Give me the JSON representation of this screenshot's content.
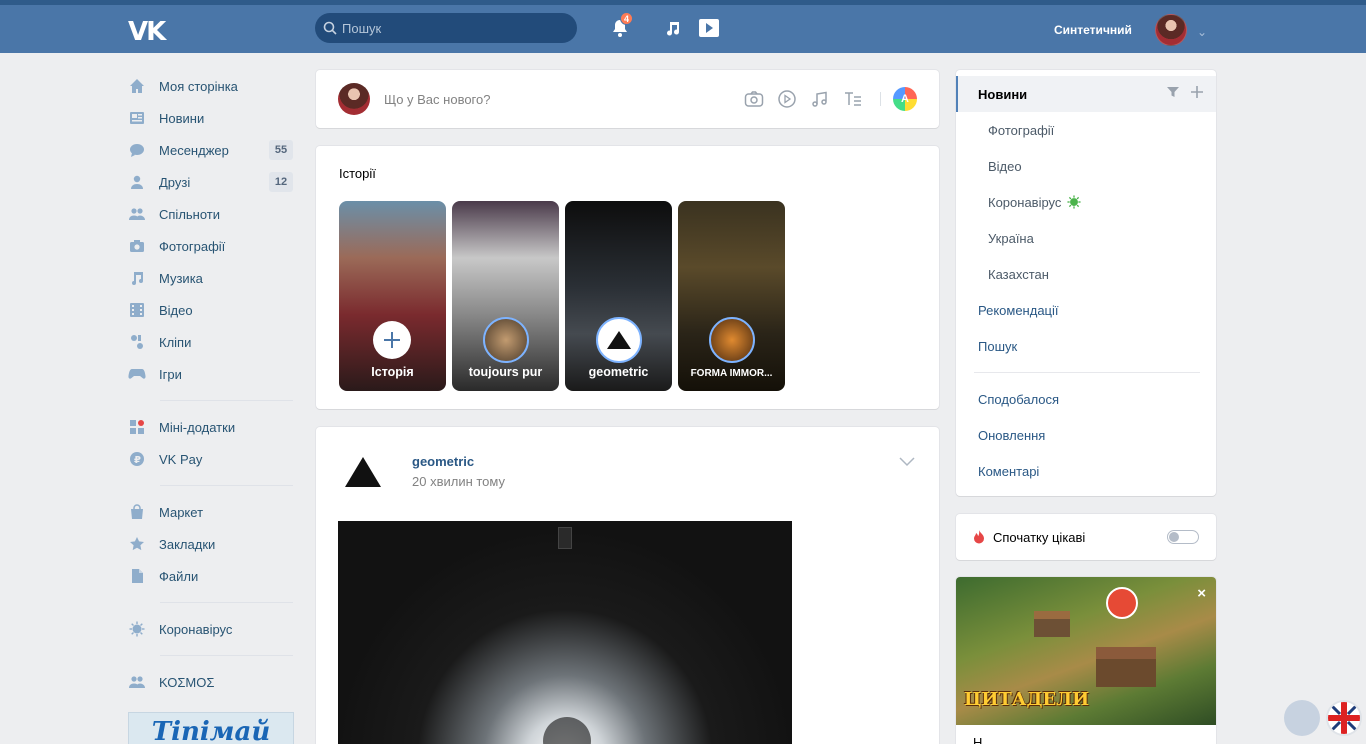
{
  "header": {
    "logo": "VK",
    "search_placeholder": "Пошук",
    "notifications_count": "4",
    "user_name": "Синтетичний"
  },
  "leftnav": {
    "items": [
      {
        "label": "Моя сторінка",
        "icon": "home-icon"
      },
      {
        "label": "Новини",
        "icon": "news-icon"
      },
      {
        "label": "Месенджер",
        "icon": "messenger-icon",
        "count": "55"
      },
      {
        "label": "Друзі",
        "icon": "friends-icon",
        "count": "12"
      },
      {
        "label": "Спільноти",
        "icon": "communities-icon"
      },
      {
        "label": "Фотографії",
        "icon": "camera-icon"
      },
      {
        "label": "Музика",
        "icon": "music-icon"
      },
      {
        "label": "Відео",
        "icon": "video-icon"
      },
      {
        "label": "Кліпи",
        "icon": "clips-icon"
      },
      {
        "label": "Ігри",
        "icon": "games-icon"
      }
    ],
    "apps": [
      {
        "label": "Міні-додатки",
        "icon": "apps-icon"
      },
      {
        "label": "VK Pay",
        "icon": "vkpay-icon"
      }
    ],
    "market": [
      {
        "label": "Маркет",
        "icon": "market-icon"
      },
      {
        "label": "Закладки",
        "icon": "bookmark-icon"
      },
      {
        "label": "Файли",
        "icon": "file-icon"
      }
    ],
    "corona": {
      "label": "Коронавірус",
      "icon": "virus-icon"
    },
    "kosmos": {
      "label": "ΚΟΣΜΟΣ",
      "icon": "group-icon"
    },
    "ad_banner_text": "Tiniмай"
  },
  "post_box": {
    "placeholder": "Що у Вас нового?",
    "avatar_badge": "A"
  },
  "stories": {
    "title": "Історії",
    "items": [
      {
        "label": "Історія"
      },
      {
        "label": "toujours pur"
      },
      {
        "label": "geometric"
      },
      {
        "label": "FORMA IMMOR..."
      }
    ]
  },
  "post": {
    "author": "geometric",
    "time": "20 хвилин тому"
  },
  "right_menu": {
    "items": [
      {
        "label": "Новини",
        "active": true
      },
      {
        "label": "Фотографії",
        "sub": true
      },
      {
        "label": "Відео",
        "sub": true
      },
      {
        "label": "Коронавірус",
        "sub": true,
        "virus": true
      },
      {
        "label": "Україна",
        "sub": true
      },
      {
        "label": "Казахстан",
        "sub": true
      },
      {
        "label": "Рекомендації"
      },
      {
        "label": "Пошук"
      }
    ],
    "items2": [
      {
        "label": "Сподобалося"
      },
      {
        "label": "Оновлення"
      },
      {
        "label": "Коментарі"
      }
    ]
  },
  "interesting_first": {
    "label": "Спочатку цікаві",
    "enabled": false
  },
  "ad": {
    "title": "ЦИТАДЕЛИ",
    "text": "Н..."
  },
  "colors": {
    "header": "#4a76a8",
    "link": "#2a5885",
    "background": "#edeef0"
  }
}
